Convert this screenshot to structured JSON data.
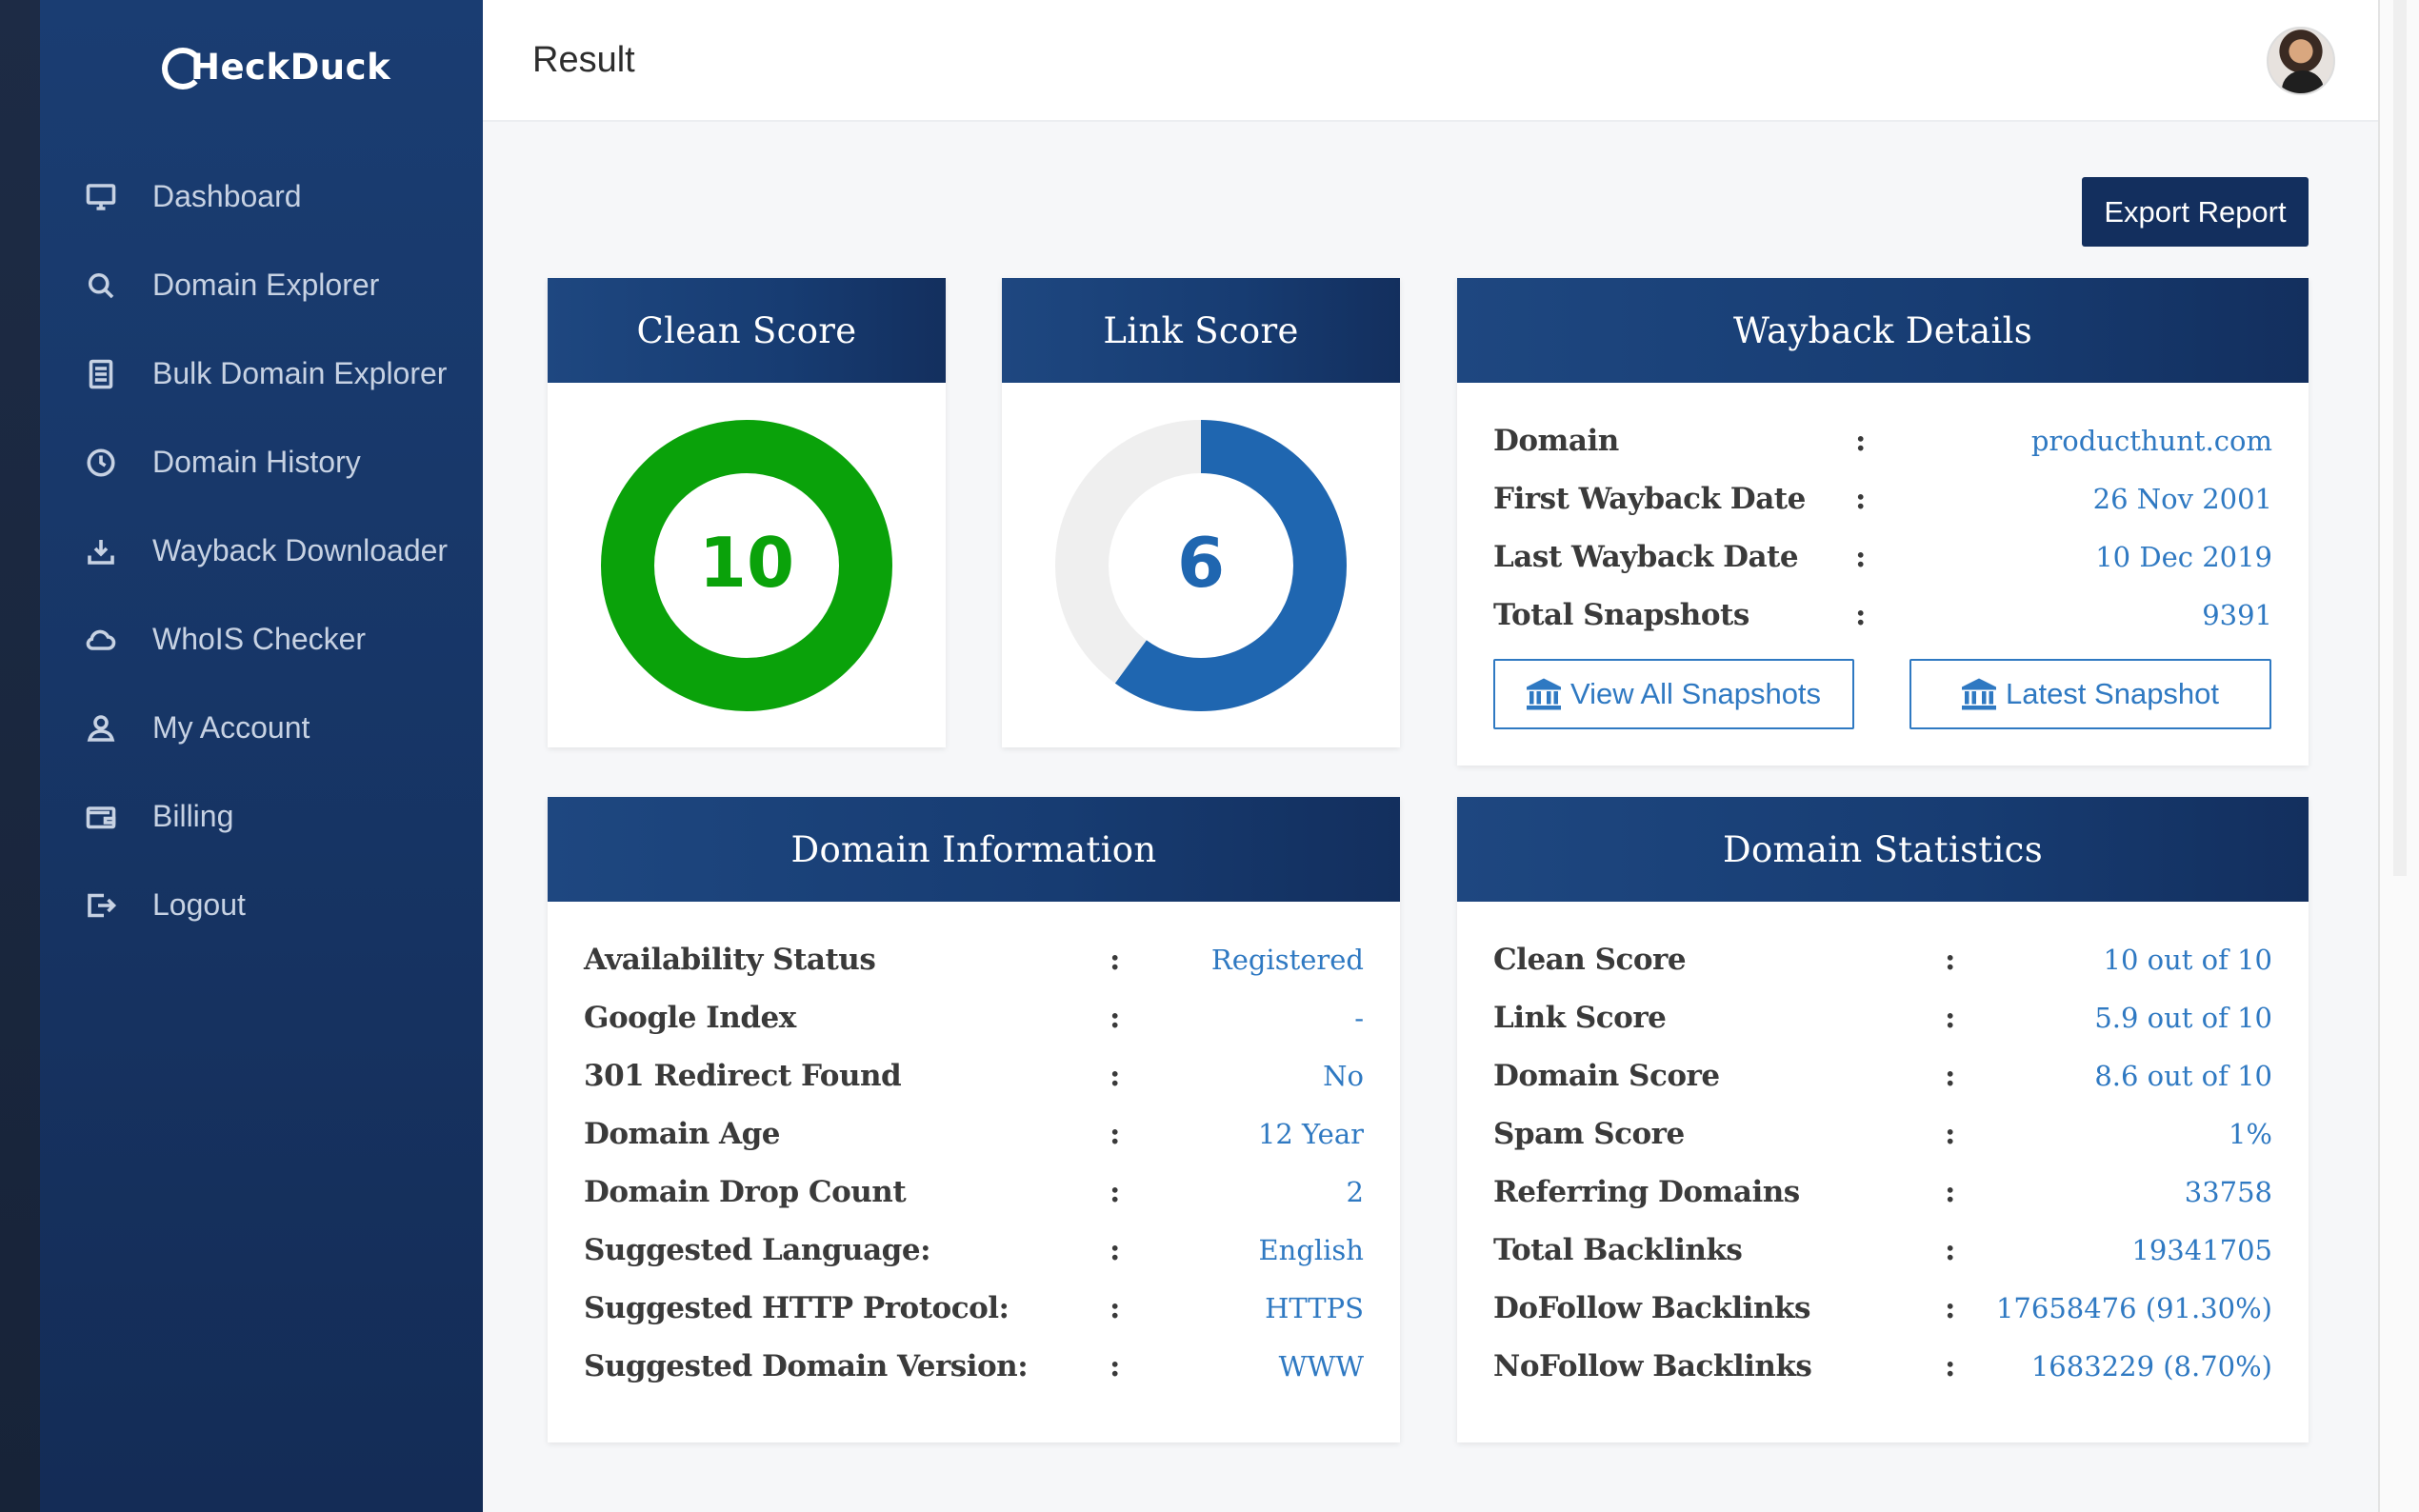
{
  "app": {
    "logo": "HeckDuck"
  },
  "sidebar": {
    "items": [
      {
        "label": "Dashboard",
        "icon": "monitor-icon"
      },
      {
        "label": "Domain Explorer",
        "icon": "search-icon"
      },
      {
        "label": "Bulk Domain Explorer",
        "icon": "document-icon"
      },
      {
        "label": "Domain History",
        "icon": "clock-icon"
      },
      {
        "label": "Wayback Downloader",
        "icon": "download-icon"
      },
      {
        "label": "WhoIS Checker",
        "icon": "cloud-icon"
      },
      {
        "label": "My Account",
        "icon": "user-icon"
      },
      {
        "label": "Billing",
        "icon": "wallet-icon"
      },
      {
        "label": "Logout",
        "icon": "logout-icon"
      }
    ]
  },
  "header": {
    "title": "Result"
  },
  "toolbar": {
    "export_label": "Export Report"
  },
  "clean_score": {
    "title": "Clean Score",
    "value": "10",
    "fraction": 1.0,
    "color": "#0aa20a"
  },
  "link_score": {
    "title": "Link Score",
    "value": "6",
    "fraction": 0.6,
    "color": "#1f66b0"
  },
  "wayback": {
    "title": "Wayback Details",
    "rows": [
      {
        "label": "Domain",
        "value": "producthunt.com"
      },
      {
        "label": "First Wayback Date",
        "value": "26 Nov 2001"
      },
      {
        "label": "Last Wayback Date",
        "value": "10 Dec 2019"
      },
      {
        "label": "Total Snapshots",
        "value": "9391"
      }
    ],
    "view_all_label": "View All Snapshots",
    "latest_label": "Latest Snapshot"
  },
  "domain_info": {
    "title": "Domain Information",
    "rows": [
      {
        "label": "Availability Status",
        "value": "Registered"
      },
      {
        "label": "Google Index",
        "value": "-"
      },
      {
        "label": "301 Redirect Found",
        "value": "No"
      },
      {
        "label": "Domain Age",
        "value": "12 Year"
      },
      {
        "label": "Domain Drop Count",
        "value": "2"
      },
      {
        "label": "Suggested Language:",
        "value": "English"
      },
      {
        "label": "Suggested HTTP Protocol:",
        "value": "HTTPS"
      },
      {
        "label": "Suggested Domain Version:",
        "value": "WWW"
      }
    ]
  },
  "domain_stats": {
    "title": "Domain Statistics",
    "rows": [
      {
        "label": "Clean Score",
        "value": "10 out of 10"
      },
      {
        "label": "Link Score",
        "value": "5.9 out of 10"
      },
      {
        "label": "Domain Score",
        "value": "8.6 out of 10"
      },
      {
        "label": "Spam Score",
        "value": "1%"
      },
      {
        "label": "Referring Domains",
        "value": "33758"
      },
      {
        "label": "Total Backlinks",
        "value": "19341705"
      },
      {
        "label": "DoFollow Backlinks",
        "value": "17658476 (91.30%)"
      },
      {
        "label": "NoFollow Backlinks",
        "value": "1683229 (8.70%)"
      }
    ]
  },
  "colon": ":"
}
